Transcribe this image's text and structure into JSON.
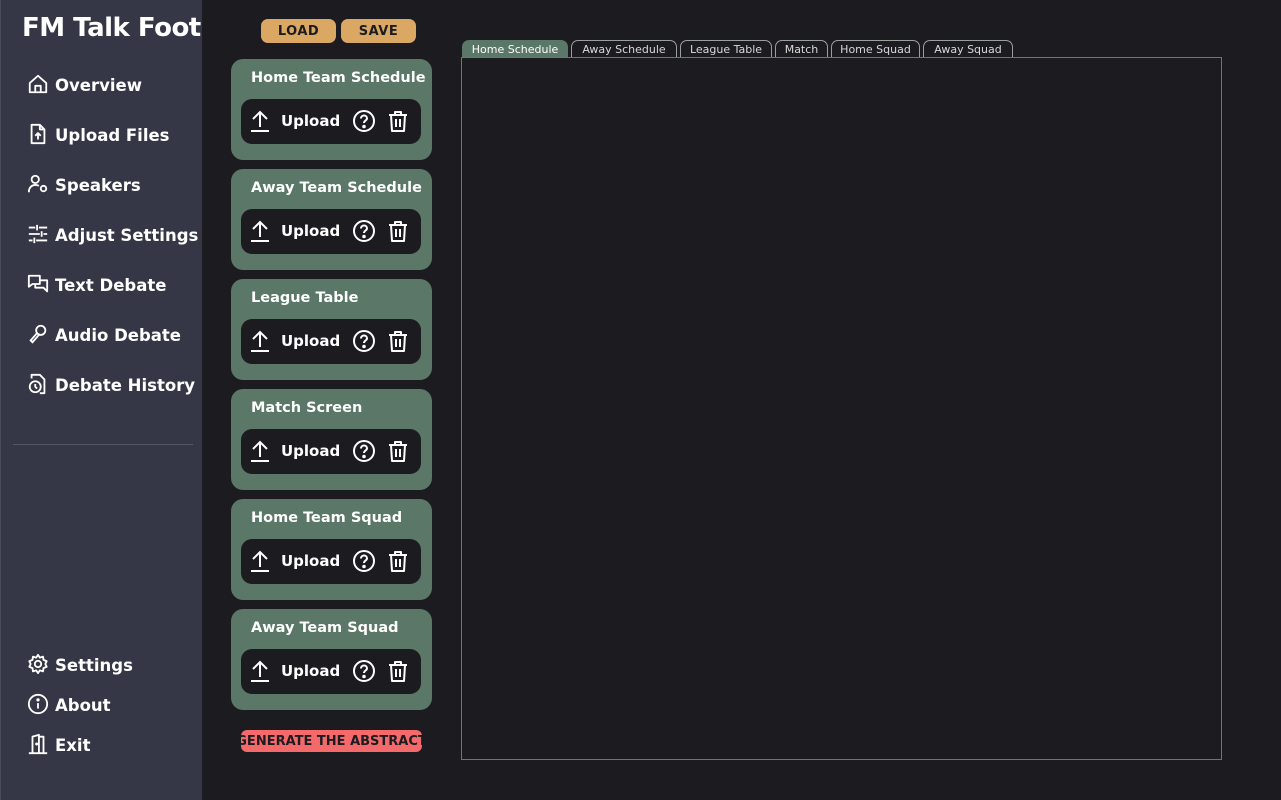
{
  "app": {
    "title": "FM Talk Foot"
  },
  "sidebar": {
    "nav": [
      {
        "label": "Overview",
        "icon": "home-icon"
      },
      {
        "label": "Upload Files",
        "icon": "file-upload-icon"
      },
      {
        "label": "Speakers",
        "icon": "user-gear-icon"
      },
      {
        "label": "Adjust Settings",
        "icon": "sliders-icon"
      },
      {
        "label": "Text Debate",
        "icon": "chat-bubbles-icon"
      },
      {
        "label": "Audio Debate",
        "icon": "microphone-icon"
      },
      {
        "label": "Debate History",
        "icon": "history-file-icon"
      }
    ],
    "bottom": [
      {
        "label": "Settings",
        "icon": "gear-icon"
      },
      {
        "label": "About",
        "icon": "info-icon"
      },
      {
        "label": "Exit",
        "icon": "exit-door-icon"
      }
    ]
  },
  "toolbar": {
    "load_label": "LOAD",
    "save_label": "SAVE"
  },
  "upload_cards": [
    {
      "title": "Home Team Schedule",
      "upload_label": "Upload"
    },
    {
      "title": "Away Team Schedule",
      "upload_label": "Upload"
    },
    {
      "title": "League Table",
      "upload_label": "Upload"
    },
    {
      "title": "Match Screen",
      "upload_label": "Upload"
    },
    {
      "title": "Home Team Squad",
      "upload_label": "Upload"
    },
    {
      "title": "Away Team Squad",
      "upload_label": "Upload"
    }
  ],
  "generate": {
    "label": "GENERATE THE ABSTRACT"
  },
  "tabs": [
    {
      "label": "Home Schedule",
      "active": true
    },
    {
      "label": "Away Schedule",
      "active": false
    },
    {
      "label": "League Table",
      "active": false
    },
    {
      "label": "Match",
      "active": false
    },
    {
      "label": "Home Squad",
      "active": false
    },
    {
      "label": "Away Squad",
      "active": false
    }
  ],
  "colors": {
    "background": "#1c1b20",
    "sidebar": "#353746",
    "card": "#5a7767",
    "toolbar_button": "#dba864",
    "generate_button": "#f46a6a"
  }
}
